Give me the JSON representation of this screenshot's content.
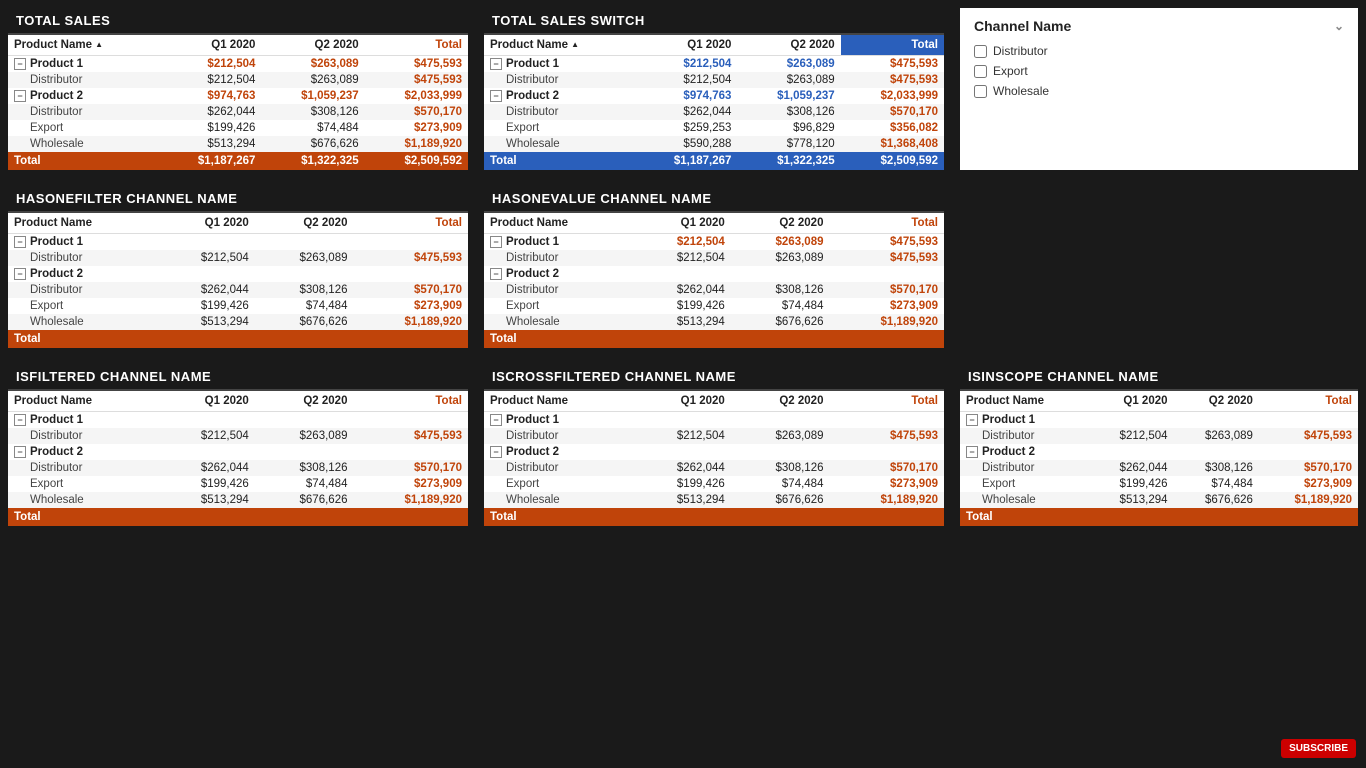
{
  "tables": {
    "total_sales": {
      "title": "TOTAL SALES",
      "header_total_class": "orange",
      "columns": [
        "Product Name",
        "Q1 2020",
        "Q2 2020",
        "Total"
      ],
      "rows": [
        {
          "type": "product",
          "indent": 0,
          "cells": [
            "Product 1",
            "$212,504",
            "$263,089",
            "$475,593"
          ]
        },
        {
          "type": "sub",
          "indent": 1,
          "cells": [
            "Distributor",
            "$212,504",
            "$263,089",
            "$475,593"
          ]
        },
        {
          "type": "product",
          "indent": 0,
          "cells": [
            "Product 2",
            "$974,763",
            "$1,059,237",
            "$2,033,999"
          ]
        },
        {
          "type": "sub",
          "indent": 1,
          "cells": [
            "Distributor",
            "$262,044",
            "$308,126",
            "$570,170"
          ]
        },
        {
          "type": "sub",
          "indent": 1,
          "cells": [
            "Export",
            "$199,426",
            "$74,484",
            "$273,909"
          ]
        },
        {
          "type": "sub",
          "indent": 1,
          "cells": [
            "Wholesale",
            "$513,294",
            "$676,626",
            "$1,189,920"
          ]
        },
        {
          "type": "total",
          "cells": [
            "Total",
            "$1,187,267",
            "$1,322,325",
            "$2,509,592"
          ]
        }
      ]
    },
    "total_sales_switch": {
      "title": "TOTAL SALES SWITCH",
      "header_total_class": "blue",
      "columns": [
        "Product Name",
        "Q1 2020",
        "Q2 2020",
        "Total"
      ],
      "rows": [
        {
          "type": "product",
          "indent": 0,
          "cells": [
            "Product 1",
            "$212,504",
            "$263,089",
            "$475,593"
          ]
        },
        {
          "type": "sub",
          "indent": 1,
          "cells": [
            "Distributor",
            "$212,504",
            "$263,089",
            "$475,593"
          ]
        },
        {
          "type": "product",
          "indent": 0,
          "cells": [
            "Product 2",
            "$974,763",
            "$1,059,237",
            "$2,033,999"
          ]
        },
        {
          "type": "sub",
          "indent": 1,
          "cells": [
            "Distributor",
            "$262,044",
            "$308,126",
            "$570,170"
          ]
        },
        {
          "type": "sub",
          "indent": 1,
          "cells": [
            "Export",
            "$259,253",
            "$96,829",
            "$356,082"
          ]
        },
        {
          "type": "sub",
          "indent": 1,
          "cells": [
            "Wholesale",
            "$590,288",
            "$778,120",
            "$1,368,408"
          ]
        },
        {
          "type": "total_blue",
          "cells": [
            "Total",
            "$1,187,267",
            "$1,322,325",
            "$2,509,592"
          ]
        }
      ]
    },
    "hasonefilter": {
      "title": "HASONEFILTER CHANNEL NAME",
      "header_total_class": "orange",
      "columns": [
        "Product Name",
        "Q1 2020",
        "Q2 2020",
        "Total"
      ],
      "rows": [
        {
          "type": "product",
          "indent": 0,
          "cells": [
            "Product 1",
            "",
            "",
            ""
          ]
        },
        {
          "type": "sub",
          "indent": 1,
          "cells": [
            "Distributor",
            "$212,504",
            "$263,089",
            "$475,593"
          ]
        },
        {
          "type": "product",
          "indent": 0,
          "cells": [
            "Product 2",
            "",
            "",
            ""
          ]
        },
        {
          "type": "sub",
          "indent": 1,
          "cells": [
            "Distributor",
            "$262,044",
            "$308,126",
            "$570,170"
          ]
        },
        {
          "type": "sub",
          "indent": 1,
          "cells": [
            "Export",
            "$199,426",
            "$74,484",
            "$273,909"
          ]
        },
        {
          "type": "sub",
          "indent": 1,
          "cells": [
            "Wholesale",
            "$513,294",
            "$676,626",
            "$1,189,920"
          ]
        },
        {
          "type": "total",
          "cells": [
            "Total",
            "",
            "",
            ""
          ]
        }
      ]
    },
    "hasonevalue": {
      "title": "HASONEVALUE CHANNEL NAME",
      "header_total_class": "orange",
      "columns": [
        "Product Name",
        "Q1 2020",
        "Q2 2020",
        "Total"
      ],
      "rows": [
        {
          "type": "product",
          "indent": 0,
          "cells": [
            "Product 1",
            "$212,504",
            "$263,089",
            "$475,593"
          ]
        },
        {
          "type": "sub",
          "indent": 1,
          "cells": [
            "Distributor",
            "$212,504",
            "$263,089",
            "$475,593"
          ]
        },
        {
          "type": "product",
          "indent": 0,
          "cells": [
            "Product 2",
            "",
            "",
            ""
          ]
        },
        {
          "type": "sub",
          "indent": 1,
          "cells": [
            "Distributor",
            "$262,044",
            "$308,126",
            "$570,170"
          ]
        },
        {
          "type": "sub",
          "indent": 1,
          "cells": [
            "Export",
            "$199,426",
            "$74,484",
            "$273,909"
          ]
        },
        {
          "type": "sub",
          "indent": 1,
          "cells": [
            "Wholesale",
            "$513,294",
            "$676,626",
            "$1,189,920"
          ]
        },
        {
          "type": "total",
          "cells": [
            "Total",
            "",
            "",
            ""
          ]
        }
      ]
    },
    "isfiltered": {
      "title": "ISFILTERED CHANNEL NAME",
      "header_total_class": "orange",
      "columns": [
        "Product Name",
        "Q1 2020",
        "Q2 2020",
        "Total"
      ],
      "rows": [
        {
          "type": "product",
          "indent": 0,
          "cells": [
            "Product 1",
            "",
            "",
            ""
          ]
        },
        {
          "type": "sub",
          "indent": 1,
          "cells": [
            "Distributor",
            "$212,504",
            "$263,089",
            "$475,593"
          ]
        },
        {
          "type": "product",
          "indent": 0,
          "cells": [
            "Product 2",
            "",
            "",
            ""
          ]
        },
        {
          "type": "sub",
          "indent": 1,
          "cells": [
            "Distributor",
            "$262,044",
            "$308,126",
            "$570,170"
          ]
        },
        {
          "type": "sub",
          "indent": 1,
          "cells": [
            "Export",
            "$199,426",
            "$74,484",
            "$273,909"
          ]
        },
        {
          "type": "sub",
          "indent": 1,
          "cells": [
            "Wholesale",
            "$513,294",
            "$676,626",
            "$1,189,920"
          ]
        },
        {
          "type": "total",
          "cells": [
            "Total",
            "",
            "",
            ""
          ]
        }
      ]
    },
    "iscrossfiltered": {
      "title": "ISCROSSFILTERED CHANNEL NAME",
      "header_total_class": "orange",
      "columns": [
        "Product Name",
        "Q1 2020",
        "Q2 2020",
        "Total"
      ],
      "rows": [
        {
          "type": "product",
          "indent": 0,
          "cells": [
            "Product 1",
            "",
            "",
            ""
          ]
        },
        {
          "type": "sub",
          "indent": 1,
          "cells": [
            "Distributor",
            "$212,504",
            "$263,089",
            "$475,593"
          ]
        },
        {
          "type": "product",
          "indent": 0,
          "cells": [
            "Product 2",
            "",
            "",
            ""
          ]
        },
        {
          "type": "sub",
          "indent": 1,
          "cells": [
            "Distributor",
            "$262,044",
            "$308,126",
            "$570,170"
          ]
        },
        {
          "type": "sub",
          "indent": 1,
          "cells": [
            "Export",
            "$199,426",
            "$74,484",
            "$273,909"
          ]
        },
        {
          "type": "sub",
          "indent": 1,
          "cells": [
            "Wholesale",
            "$513,294",
            "$676,626",
            "$1,189,920"
          ]
        },
        {
          "type": "total",
          "cells": [
            "Total",
            "",
            "",
            ""
          ]
        }
      ]
    },
    "isinscope": {
      "title": "ISINSCOPE CHANNEL NAME",
      "header_total_class": "orange",
      "columns": [
        "Product Name",
        "Q1 2020",
        "Q2 2020",
        "Total"
      ],
      "rows": [
        {
          "type": "product",
          "indent": 0,
          "cells": [
            "Product 1",
            "",
            "",
            ""
          ]
        },
        {
          "type": "sub",
          "indent": 1,
          "cells": [
            "Distributor",
            "$212,504",
            "$263,089",
            "$475,593"
          ]
        },
        {
          "type": "product",
          "indent": 0,
          "cells": [
            "Product 2",
            "",
            "",
            ""
          ]
        },
        {
          "type": "sub",
          "indent": 1,
          "cells": [
            "Distributor",
            "$262,044",
            "$308,126",
            "$570,170"
          ]
        },
        {
          "type": "sub",
          "indent": 1,
          "cells": [
            "Export",
            "$199,426",
            "$74,484",
            "$273,909"
          ]
        },
        {
          "type": "sub",
          "indent": 1,
          "cells": [
            "Wholesale",
            "$513,294",
            "$676,626",
            "$1,189,920"
          ]
        },
        {
          "type": "total",
          "cells": [
            "Total",
            "",
            "",
            ""
          ]
        }
      ]
    }
  },
  "filter_panel": {
    "title": "Channel Name",
    "items": [
      "Distributor",
      "Export",
      "Wholesale"
    ]
  },
  "subscribe": "SUBSCRIBE"
}
